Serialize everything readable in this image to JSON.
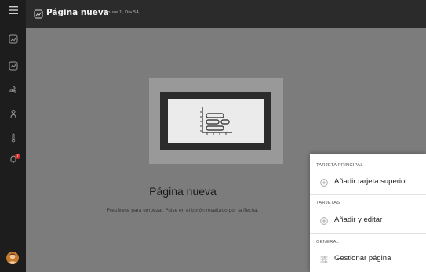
{
  "header": {
    "title": "Página nueva",
    "subtitle": "House 1, Día 54"
  },
  "sidebar": {
    "items": [
      {
        "icon": "menu-icon"
      },
      {
        "icon": "dashboard-icon"
      },
      {
        "icon": "page-icon"
      },
      {
        "icon": "fan-icon"
      },
      {
        "icon": "bird-icon"
      },
      {
        "icon": "thermometer-icon"
      },
      {
        "icon": "notification-icon",
        "badge": "7"
      }
    ]
  },
  "main": {
    "heading": "Página nueva",
    "hint": "Prepárese para empezar. Pulse en el botón resaltado por la flecha."
  },
  "menu": {
    "sections": [
      {
        "title": "TARJETA PRINCIPAL",
        "item": {
          "label": "Añadir tarjeta superior",
          "icon": "plus-circle-icon"
        }
      },
      {
        "title": "TARJETAS",
        "item": {
          "label": "Añadir y editar",
          "icon": "plus-circle-icon"
        }
      },
      {
        "title": "GENERAL",
        "item": {
          "label": "Gestionar página",
          "icon": "sliders-icon"
        }
      }
    ]
  },
  "colors": {
    "sidebar": "#1d1d1d",
    "topbar": "#2b2b2b",
    "overlay": "#7c7c7c",
    "badge": "#d0312d"
  }
}
